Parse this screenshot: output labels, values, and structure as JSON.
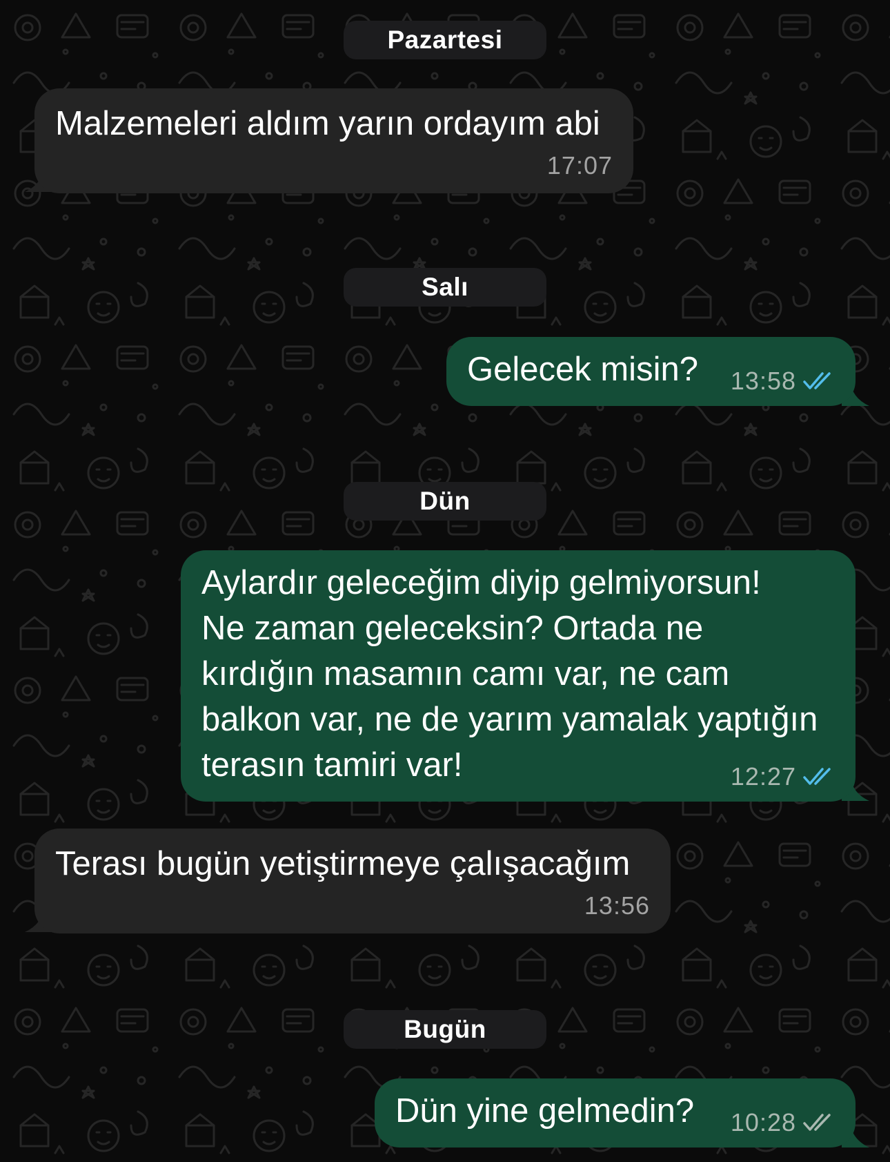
{
  "colors": {
    "background": "#0b0b0b",
    "incoming_bubble": "#242424",
    "outgoing_bubble": "#144d37",
    "date_pill": "#1c1c1e",
    "read_ticks": "#53bdeb",
    "delivered_ticks": "#a9b8b0"
  },
  "dates": {
    "monday": "Pazartesi",
    "tuesday": "Salı",
    "yesterday": "Dün",
    "today": "Bugün"
  },
  "messages": [
    {
      "direction": "in",
      "text": "Malzemeleri aldım yarın ordayım abi",
      "time": "17:07"
    },
    {
      "direction": "out",
      "text": "Gelecek misin?",
      "time": "13:58",
      "status_icon": "double-check-read-icon"
    },
    {
      "direction": "out",
      "text": "Aylardır geleceğim diyip gelmiyorsun!\nNe zaman geleceksin? Ortada ne\nkırdığın masamın camı var, ne cam\nbalkon var, ne de yarım yamalak yaptığın\nterasın tamiri var!",
      "time": "12:27",
      "status_icon": "double-check-read-icon"
    },
    {
      "direction": "in",
      "text": "Terası bugün yetiştirmeye çalışacağım",
      "time": "13:56"
    },
    {
      "direction": "out",
      "text": "Dün yine gelmedin?",
      "time": "10:28",
      "status_icon": "double-check-delivered-icon"
    }
  ]
}
